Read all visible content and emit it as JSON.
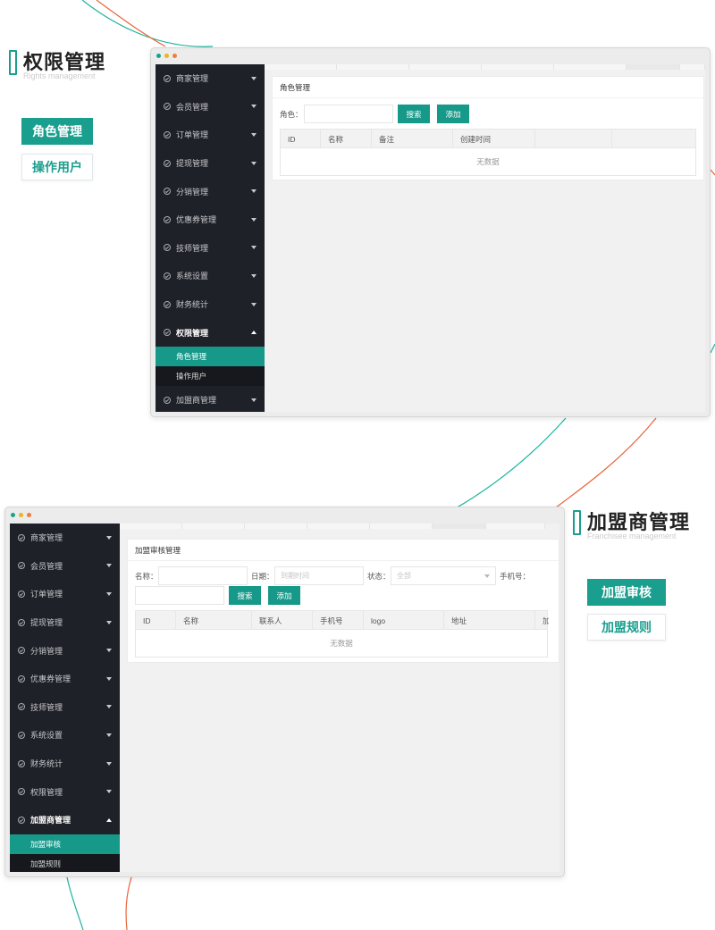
{
  "rights": {
    "heading": "权限管理",
    "subheading": "Rights management",
    "features": [
      "角色管理",
      "操作用户"
    ]
  },
  "franchise": {
    "heading": "加盟商管理",
    "subheading": "Franchisee management",
    "features": [
      "加盟审核",
      "加盟规则"
    ]
  },
  "nav": {
    "items": [
      "商家管理",
      "会员管理",
      "订单管理",
      "提现管理",
      "分销管理",
      "优惠券管理",
      "技师管理",
      "系统设置",
      "财务统计",
      "权限管理",
      "加盟商管理"
    ],
    "rights_sub": [
      "角色管理",
      "操作用户"
    ],
    "franchise_sub": [
      "加盟审核",
      "加盟规则"
    ]
  },
  "role_page": {
    "title": "角色管理",
    "role_label": "角色：",
    "search": "搜索",
    "add": "添加",
    "columns": [
      "ID",
      "名称",
      "备注",
      "创建时间",
      "",
      ""
    ],
    "empty": "无数据"
  },
  "audit_page": {
    "title": "加盟审核管理",
    "name_label": "名称：",
    "date_label": "日期：",
    "date_placeholder": "到期时间",
    "status_label": "状态：",
    "status_value": "全部",
    "phone_label": "手机号：",
    "search": "搜索",
    "add": "添加",
    "columns": [
      "ID",
      "名称",
      "联系人",
      "手机号",
      "logo",
      "地址",
      "加"
    ],
    "empty": "无数据"
  },
  "colors": {
    "accent": "#1a9e8e",
    "sidebar": "#1f2128",
    "decor_orange": "#e8643a",
    "decor_teal": "#1db39c",
    "dot_green": "#1aa38c",
    "dot_yellow": "#f0b419",
    "dot_orange": "#f27c3b"
  }
}
